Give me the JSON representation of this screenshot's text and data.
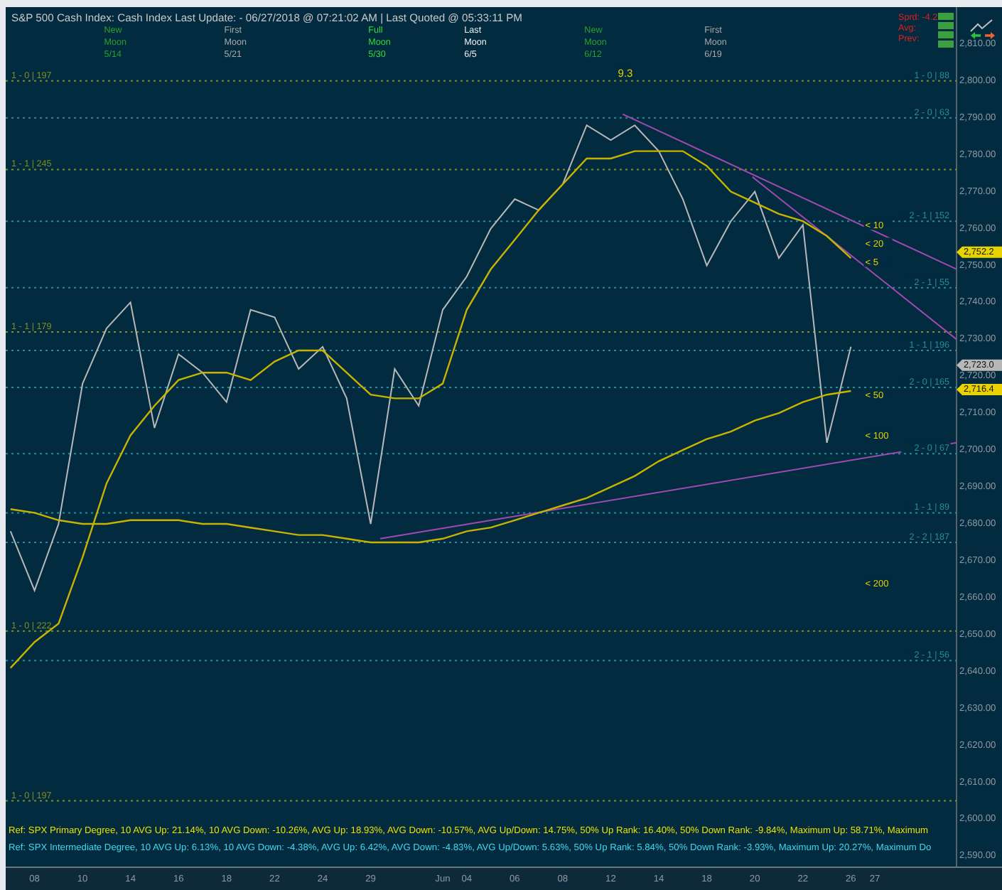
{
  "header": {
    "title": "S&P 500 Cash Index:  Cash Index  Last Update:  - 06/27/2018 @ 07:21:02 AM | Last Quoted @ 05:33:11 PM",
    "moon_phases": [
      {
        "kind": "new",
        "lines": [
          "New",
          "Moon",
          "5/14"
        ]
      },
      {
        "kind": "first",
        "lines": [
          "First",
          "Moon",
          "5/21"
        ]
      },
      {
        "kind": "full",
        "lines": [
          "Full",
          "Moon",
          "5/30"
        ]
      },
      {
        "kind": "last",
        "lines": [
          "Last",
          "Moon",
          "6/5"
        ]
      },
      {
        "kind": "new",
        "lines": [
          "New",
          "Moon",
          "6/12"
        ]
      },
      {
        "kind": "first",
        "lines": [
          "First",
          "Moon",
          "6/19"
        ]
      }
    ],
    "stats": [
      "Sprd: -4.2",
      "Avg:",
      "Prev:"
    ]
  },
  "chart": {
    "chart_data": {
      "type": "line",
      "categories": [
        null,
        "08",
        null,
        "10",
        null,
        "14",
        null,
        "16",
        null,
        "18",
        null,
        "22",
        null,
        "24",
        null,
        "29",
        null,
        null,
        "Jun",
        "04",
        null,
        "06",
        null,
        "08",
        null,
        "12",
        null,
        "14",
        null,
        "18",
        null,
        "20",
        null,
        "22",
        null,
        "26",
        "27",
        null,
        null,
        null
      ],
      "series": [
        {
          "color": "#b8b8b8",
          "values": [
            2678,
            2662,
            2680,
            2718,
            2733,
            2740,
            2706,
            2726,
            2721,
            2713,
            2738,
            2736,
            2722,
            2728,
            2714,
            2680,
            2722,
            2712,
            2738,
            2747,
            2760,
            2768,
            2765,
            2772,
            2788,
            2784,
            2788,
            2781,
            2768,
            2750,
            2762,
            2770,
            2752,
            2761,
            2702,
            2728,
            null,
            null,
            null,
            null
          ]
        },
        {
          "color": "#c8b400",
          "values": [
            2641,
            2648,
            2653,
            2671,
            2691,
            2704,
            2712,
            2719,
            2721,
            2721,
            2719,
            2724,
            2727,
            2727,
            2721,
            2715,
            2714,
            2714,
            2718,
            2738,
            2749,
            2757,
            2765,
            2772,
            2779,
            2779,
            2781,
            2781,
            2781,
            2777,
            2770,
            2767,
            2764,
            2762,
            2758,
            2752,
            null,
            null,
            null,
            null
          ]
        },
        {
          "color": "#c8b400",
          "values": [
            2684,
            2683,
            2681,
            2680,
            2680,
            2681,
            2681,
            2681,
            2680,
            2680,
            2679,
            2678,
            2677,
            2677,
            2676,
            2675,
            2675,
            2675,
            2676,
            2678,
            2679,
            2681,
            2683,
            2685,
            2687,
            2690,
            2693,
            2697,
            2700,
            2703,
            2705,
            2708,
            2710,
            2713,
            2715,
            2716,
            null,
            null,
            null,
            null
          ]
        }
      ],
      "ylim": [
        2587,
        2820
      ],
      "yticks": [
        {
          "value": 2590,
          "label": "2,590.00"
        },
        {
          "value": 2600,
          "label": "2,600.00"
        },
        {
          "value": 2610,
          "label": "2,610.00"
        },
        {
          "value": 2620,
          "label": "2,620.00"
        },
        {
          "value": 2630,
          "label": "2,630.00"
        },
        {
          "value": 2640,
          "label": "2,640.00"
        },
        {
          "value": 2650,
          "label": "2,650.00"
        },
        {
          "value": 2660,
          "label": "2,660.00"
        },
        {
          "value": 2670,
          "label": "2,670.00"
        },
        {
          "value": 2680,
          "label": "2,680.00"
        },
        {
          "value": 2690,
          "label": "2,690.00"
        },
        {
          "value": 2700,
          "label": "2,700.00"
        },
        {
          "value": 2710,
          "label": "2,710.00"
        },
        {
          "value": 2720,
          "label": "2,720.00"
        },
        {
          "value": 2730,
          "label": "2,730.00"
        },
        {
          "value": 2740,
          "label": "2,740.00"
        },
        {
          "value": 2750,
          "label": "2,750.00"
        },
        {
          "value": 2760,
          "label": "2,760.00"
        },
        {
          "value": 2770,
          "label": "2,770.00"
        },
        {
          "value": 2780,
          "label": "2,780.00"
        },
        {
          "value": 2790,
          "label": "2,790.00"
        },
        {
          "value": 2800,
          "label": "2,800.00"
        },
        {
          "value": 2810,
          "label": "2,810.00"
        }
      ],
      "ref_lines": [
        {
          "axis": "y",
          "value": 2800,
          "color": "#7f8f22"
        },
        {
          "axis": "y",
          "value": 2790,
          "color": "#2a8c9a"
        },
        {
          "axis": "y",
          "value": 2776,
          "color": "#7f8f22"
        },
        {
          "axis": "y",
          "value": 2762,
          "color": "#2a8c9a"
        },
        {
          "axis": "y",
          "value": 2744,
          "color": "#2a8c9a"
        },
        {
          "axis": "y",
          "value": 2732,
          "color": "#7f8f22"
        },
        {
          "axis": "y",
          "value": 2727,
          "color": "#2a8c9a"
        },
        {
          "axis": "y",
          "value": 2717,
          "color": "#2a8c9a"
        },
        {
          "axis": "y",
          "value": 2699,
          "color": "#2a8c9a"
        },
        {
          "axis": "y",
          "value": 2683,
          "color": "#2a8c9a"
        },
        {
          "axis": "y",
          "value": 2675,
          "color": "#2a8c9a"
        },
        {
          "axis": "y",
          "value": 2651,
          "color": "#7f8f22"
        },
        {
          "axis": "y",
          "value": 2643,
          "color": "#2a8c9a"
        },
        {
          "axis": "y",
          "value": 2605,
          "color": "#7f8f22"
        }
      ],
      "annotations": [
        "9.3",
        "< 10",
        "< 20",
        "< 5",
        "< 50",
        "< 100",
        "< 200"
      ]
    },
    "level_lines": [
      {
        "label": "1 - 0 | 197",
        "color": "#7f8f22"
      },
      {
        "label": "1 - 0 | 88",
        "color": "#2a8c9a"
      },
      {
        "label": "2 - 0 | 63",
        "color": "#2a8c9a"
      },
      {
        "label": "1 - 1 | 245",
        "color": "#7f8f22"
      },
      {
        "label": "2 - 1 | 152",
        "color": "#2a8c9a"
      },
      {
        "label": "2 - 1 | 55",
        "color": "#2a8c9a"
      },
      {
        "label": "1 - 1 | 179",
        "color": "#7f8f22"
      },
      {
        "label": "1 - 1 | 196",
        "color": "#2a8c9a"
      },
      {
        "label": "2 - 0 | 165",
        "color": "#2a8c9a"
      },
      {
        "label": "2 - 0 | 67",
        "color": "#2a8c9a"
      },
      {
        "label": "1 - 1 | 89",
        "color": "#2a8c9a"
      },
      {
        "label": "2 - 2 | 187",
        "color": "#2a8c9a"
      },
      {
        "label": "1 - 0 | 222",
        "color": "#7f8f22"
      },
      {
        "label": "2 - 1 | 56",
        "color": "#2a8c9a"
      },
      {
        "label": "1 - 0 | 197",
        "color": "#7f8f22"
      }
    ],
    "value_tags": [
      {
        "text": "2,752.2",
        "color": "#e8d200"
      },
      {
        "text": "2,723.0",
        "color": "#b8b8b8"
      },
      {
        "text": "2,716.4",
        "color": "#e8d200"
      }
    ]
  },
  "footer_lines": [
    {
      "text": "Ref: SPX Primary Degree, 10 AVG Up: 21.14%, 10 AVG Down: -10.26%, AVG Up: 18.93%, AVG Down: -10.57%, AVG Up/Down: 14.75%, 50%  Up Rank: 16.40%, 50% Down Rank: -9.84%, Maximum Up: 58.71%, Maximum",
      "color": "#e8e000"
    },
    {
      "text": "Ref: SPX Intermediate Degree, 10 AVG Up: 6.13%, 10 AVG Down: -4.38%, AVG Up: 6.42%, AVG Down: -4.83%, AVG Up/Down: 5.63%, 50%  Up Rank: 5.84%, 50% Down Rank: -3.93%, Maximum Up: 20.27%, Maximum Do",
      "color": "#40d8e8"
    }
  ]
}
